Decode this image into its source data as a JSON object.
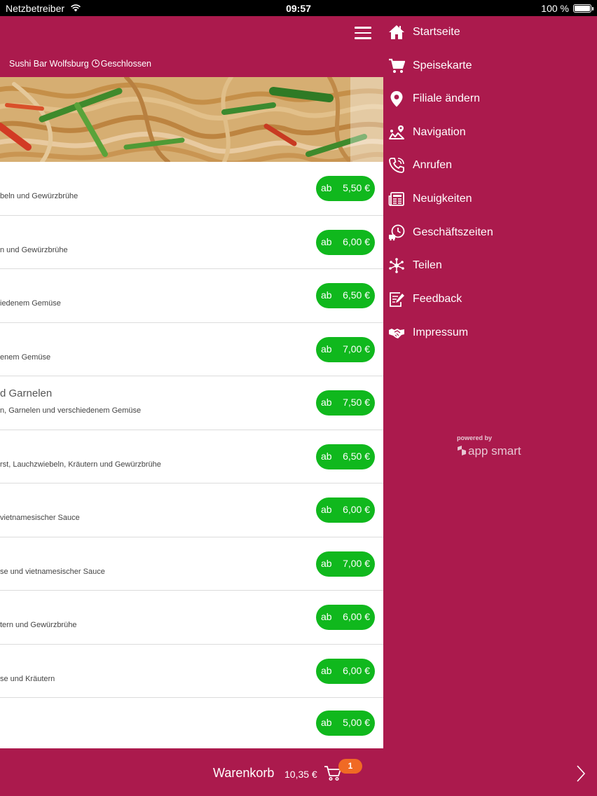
{
  "status_bar": {
    "carrier": "Netzbetreiber",
    "time": "09:57",
    "battery": "100 %"
  },
  "header": {
    "shop_name": "Sushi Bar Wolfsburg",
    "status": "Geschlossen"
  },
  "menu_items": [
    {
      "title": "",
      "description": "beln und Gewürzbrühe",
      "prefix": "ab",
      "price": "5,50 €"
    },
    {
      "title": "",
      "description": "n und Gewürzbrühe",
      "prefix": "ab",
      "price": "6,00 €"
    },
    {
      "title": "",
      "description": "iedenem Gemüse",
      "prefix": "ab",
      "price": "6,50 €"
    },
    {
      "title": "",
      "description": "enem Gemüse",
      "prefix": "ab",
      "price": "7,00 €"
    },
    {
      "title": "d Garnelen",
      "description": "n, Garnelen und verschiedenem Gemüse",
      "prefix": "ab",
      "price": "7,50 €"
    },
    {
      "title": "",
      "description": "rst, Lauchzwiebeln, Kräutern und Gewürzbrühe",
      "prefix": "ab",
      "price": "6,50 €"
    },
    {
      "title": "",
      "description": "vietnamesischer Sauce",
      "prefix": "ab",
      "price": "6,00 €"
    },
    {
      "title": "",
      "description": "se und vietnamesischer Sauce",
      "prefix": "ab",
      "price": "7,00 €"
    },
    {
      "title": "",
      "description": "tern und Gewürzbrühe",
      "prefix": "ab",
      "price": "6,00 €"
    },
    {
      "title": "",
      "description": "se und Kräutern",
      "prefix": "ab",
      "price": "6,00 €"
    },
    {
      "title": "",
      "description": "",
      "prefix": "ab",
      "price": "5,00 €"
    }
  ],
  "side_menu": {
    "items": [
      {
        "label": "Startseite",
        "icon": "home-icon"
      },
      {
        "label": "Speisekarte",
        "icon": "cart-icon"
      },
      {
        "label": "Filiale ändern",
        "icon": "location-pin-icon"
      },
      {
        "label": "Navigation",
        "icon": "map-route-icon"
      },
      {
        "label": "Anrufen",
        "icon": "phone-icon"
      },
      {
        "label": "Neuigkeiten",
        "icon": "newspaper-icon"
      },
      {
        "label": "Geschäftszeiten",
        "icon": "delivery-clock-icon"
      },
      {
        "label": "Teilen",
        "icon": "share-icon"
      },
      {
        "label": "Feedback",
        "icon": "feedback-icon"
      },
      {
        "label": "Impressum",
        "icon": "handshake-icon"
      }
    ],
    "powered_by": "powered by",
    "brand": "app smart"
  },
  "cart": {
    "label": "Warenkorb",
    "total": "10,35 €",
    "badge": "1"
  },
  "colors": {
    "brand": "#ab1a4d",
    "price_pill": "#10b81d",
    "badge": "#f06a24"
  }
}
